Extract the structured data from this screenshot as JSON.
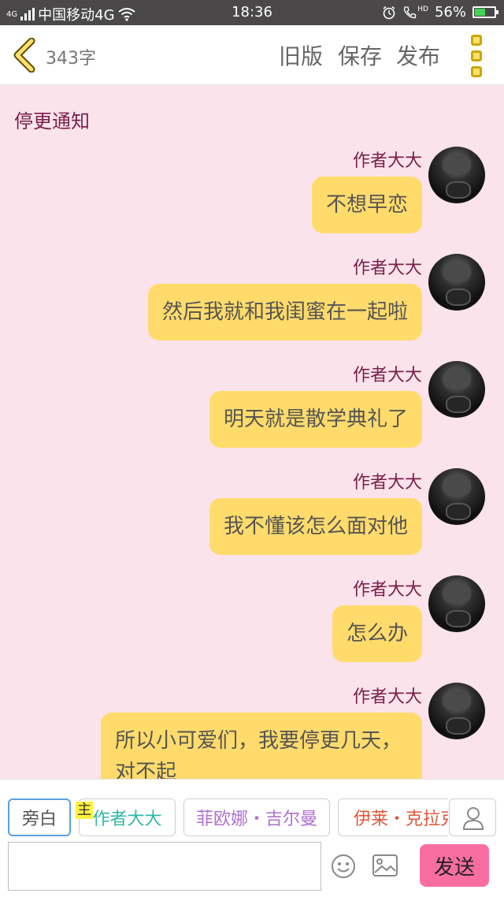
{
  "status_bar": {
    "network_small": "4G",
    "carrier": "中国移动4G",
    "time": "18:36",
    "hd": "HD",
    "battery": "56%",
    "battery_level": 0.56
  },
  "topbar": {
    "word_count": "343字",
    "old_version": "旧版",
    "save": "保存",
    "publish": "发布"
  },
  "notice": "停更通知",
  "messages": [
    {
      "author": "作者大大",
      "text": "不想早恋"
    },
    {
      "author": "作者大大",
      "text": "然后我就和我闺蜜在一起啦"
    },
    {
      "author": "作者大大",
      "text": "明天就是散学典礼了"
    },
    {
      "author": "作者大大",
      "text": "我不懂该怎么面对他"
    },
    {
      "author": "作者大大",
      "text": "怎么办"
    },
    {
      "author": "作者大大",
      "text": "所以小可爱们，我要停更几天，对不起"
    }
  ],
  "roles": [
    {
      "label": "旁白",
      "color": "#555555"
    },
    {
      "label": "作者大大",
      "color": "#2fb8a8",
      "tag": "主"
    },
    {
      "label": "菲欧娜・吉尔曼",
      "color": "#b06fd0"
    },
    {
      "label": "伊莱・克拉克",
      "color": "#e0563a"
    }
  ],
  "input": {
    "placeholder": ""
  },
  "send_label": "发送",
  "colors": {
    "background": "#fbe3ec",
    "bubble": "#ffdb6b",
    "name": "#7a1f4a",
    "send_button": "#f96ea0",
    "more_icon": "#ffe16a"
  }
}
